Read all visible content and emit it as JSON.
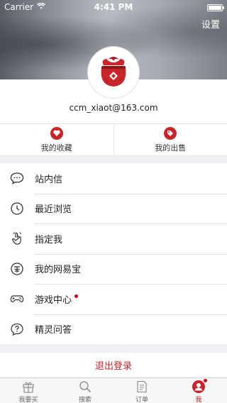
{
  "status_bar": {
    "carrier": "Carrier",
    "time": "4:41 PM"
  },
  "header": {
    "settings_label": "设置"
  },
  "profile": {
    "email": "ccm_xiaot@163.com"
  },
  "actions": [
    {
      "label": "我的收藏",
      "icon": "heart-icon"
    },
    {
      "label": "我的出售",
      "icon": "tag-icon"
    }
  ],
  "menu": [
    {
      "label": "站内信",
      "icon": "message-icon",
      "badge": false
    },
    {
      "label": "最近浏览",
      "icon": "clock-icon",
      "badge": false
    },
    {
      "label": "指定我",
      "icon": "pointing-hand-icon",
      "badge": false
    },
    {
      "label": "我的网易宝",
      "icon": "wallet-icon",
      "badge": false
    },
    {
      "label": "游戏中心",
      "icon": "gamepad-icon",
      "badge": true
    },
    {
      "label": "精灵问答",
      "icon": "question-icon",
      "badge": false
    }
  ],
  "logout_label": "退出登录",
  "tabbar": [
    {
      "label": "我要买",
      "icon": "gift-icon",
      "active": false
    },
    {
      "label": "搜索",
      "icon": "search-icon",
      "active": false
    },
    {
      "label": "订单",
      "icon": "document-icon",
      "active": false
    },
    {
      "label": "我",
      "icon": "person-icon",
      "active": true,
      "badge": true
    }
  ],
  "colors": {
    "accent": "#c8242a",
    "badge": "#d0021b",
    "background": "#efeff4"
  }
}
